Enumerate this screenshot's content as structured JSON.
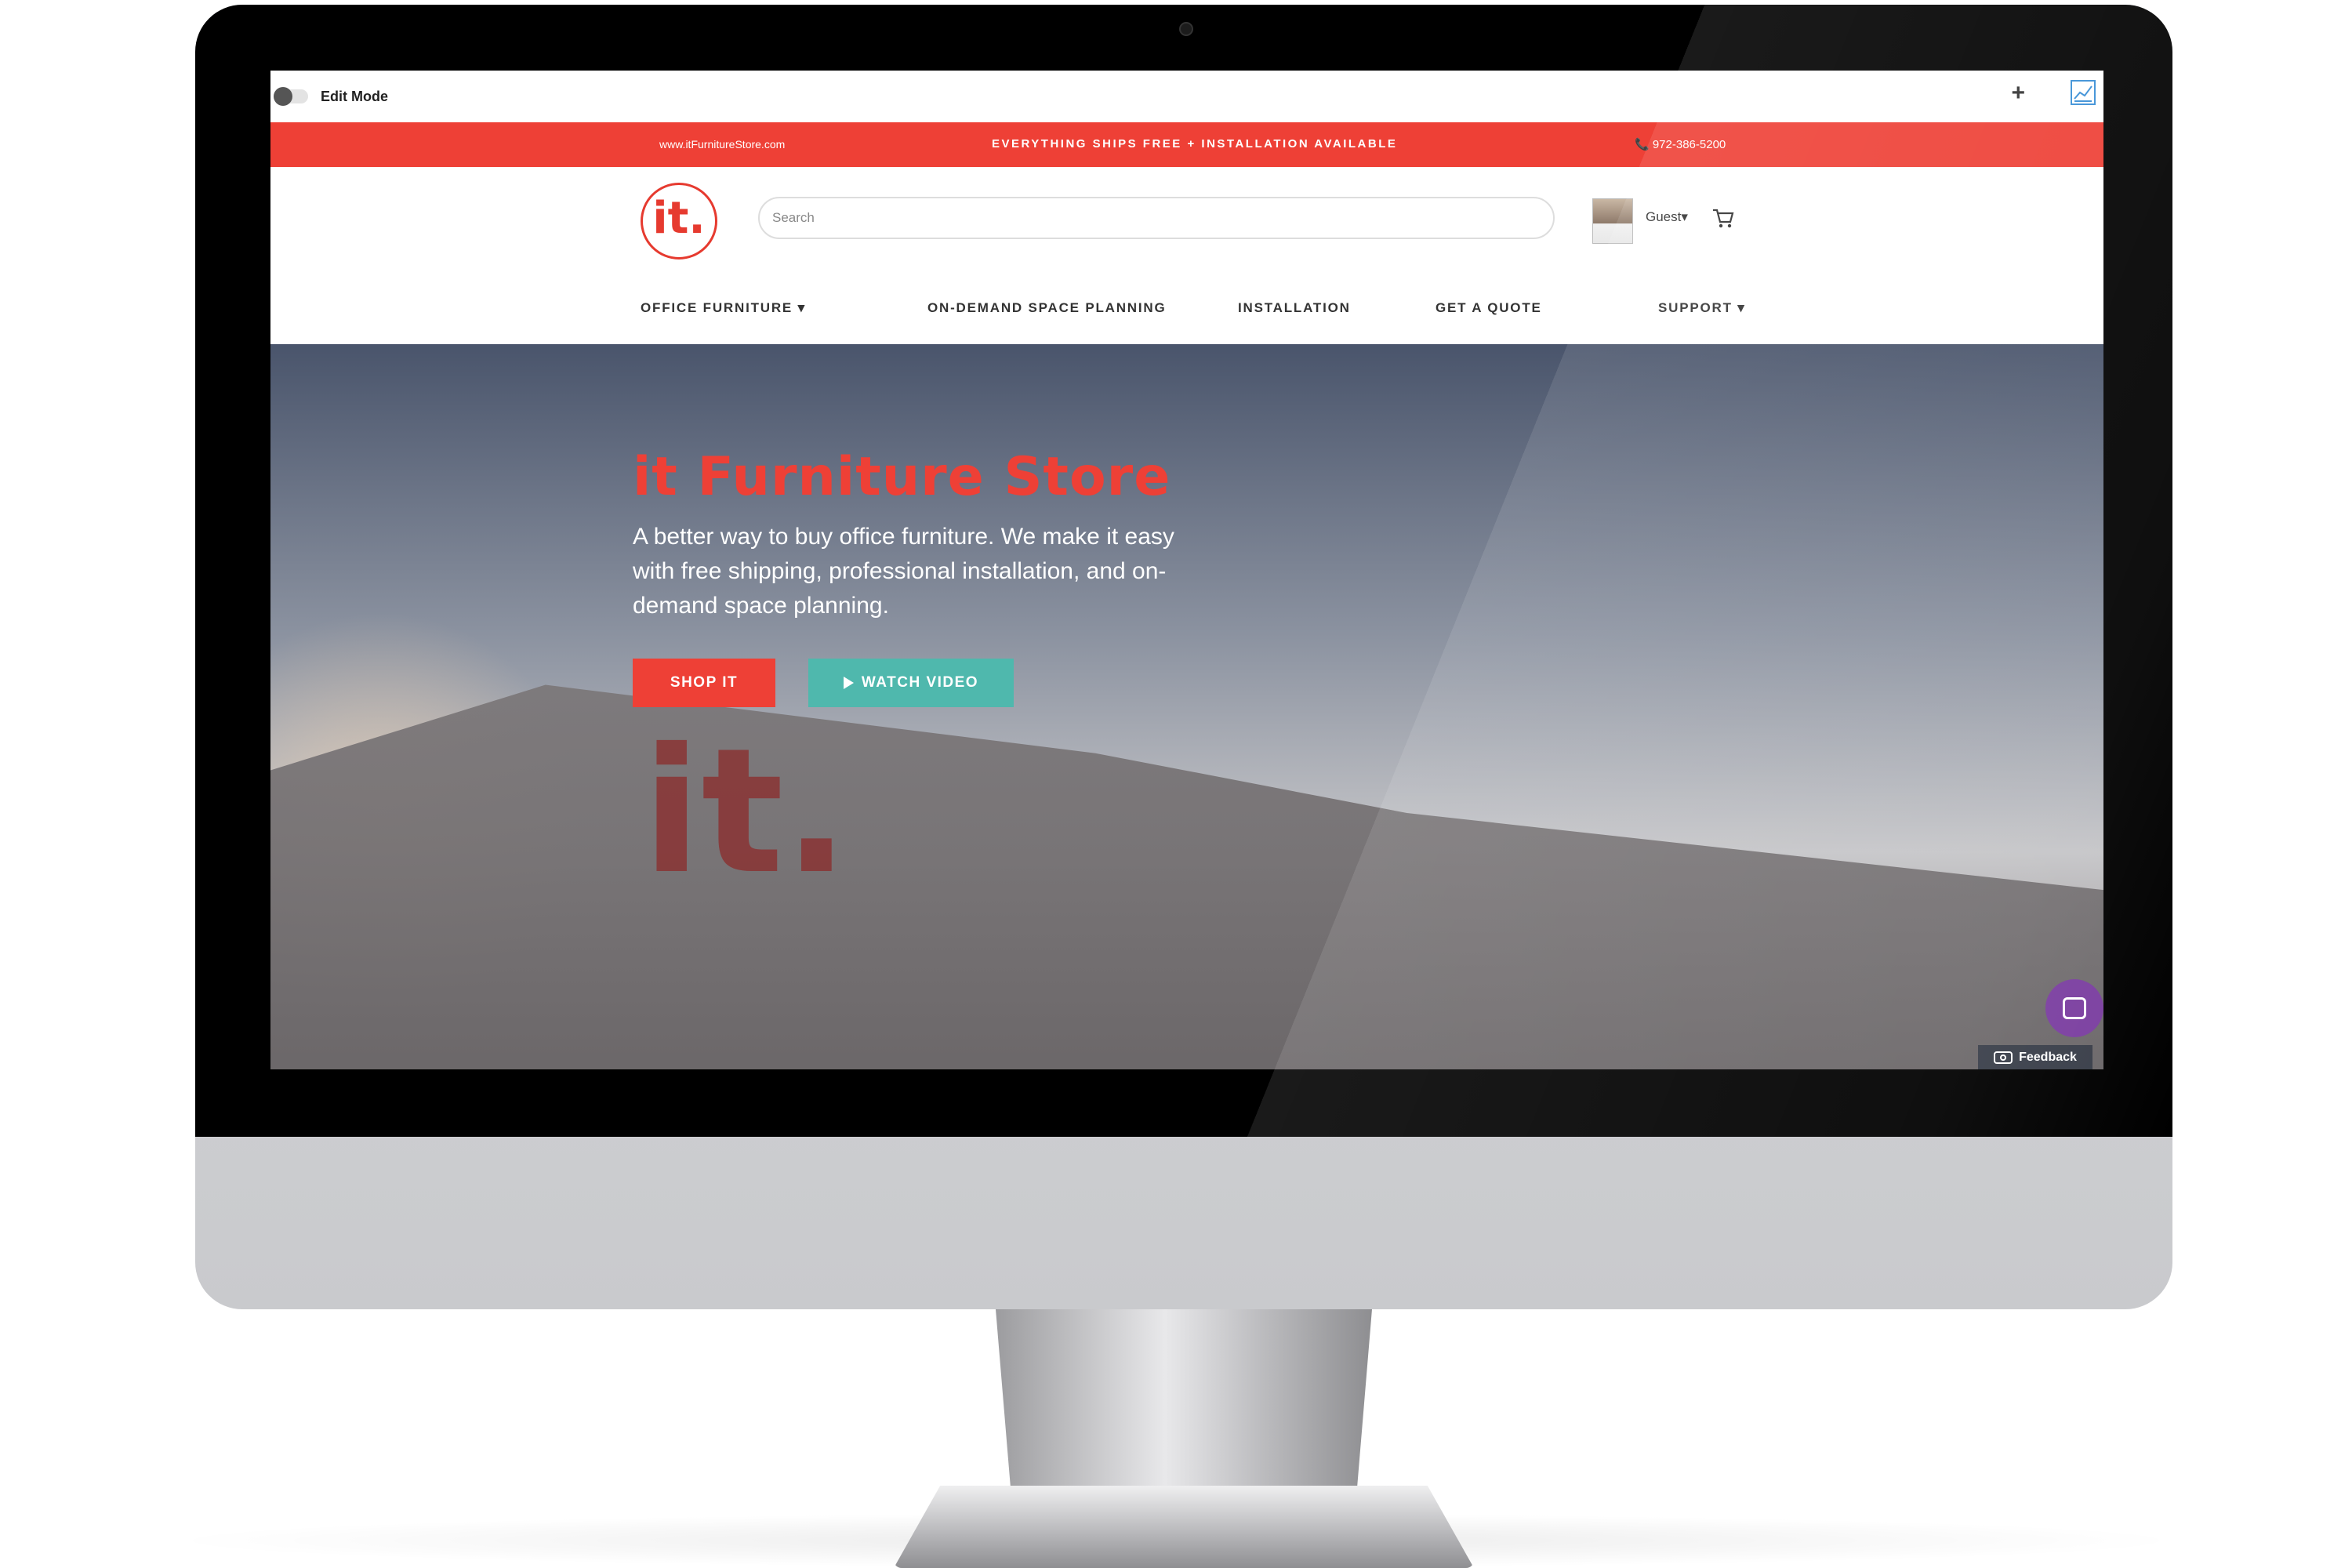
{
  "edit_bar": {
    "label": "Edit Mode",
    "plus": "+"
  },
  "promo": {
    "url": "www.itFurnitureStore.com",
    "message": "EVERYTHING SHIPS FREE + INSTALLATION AVAILABLE",
    "phone": "📞 972-386-5200"
  },
  "header": {
    "logo_text": "it.",
    "search_placeholder": "Search",
    "user_label": "Guest▾"
  },
  "nav": [
    {
      "label": "OFFICE FURNITURE ▾"
    },
    {
      "label": "ON-DEMAND SPACE PLANNING"
    },
    {
      "label": "INSTALLATION"
    },
    {
      "label": "GET A QUOTE"
    },
    {
      "label": "SUPPORT ▾"
    }
  ],
  "hero": {
    "title": "it Furniture Store",
    "description": "A better way to buy office furniture. We make it easy with free shipping, professional installation, and on-demand space planning.",
    "shop_button": "SHOP IT",
    "video_button": "WATCH VIDEO",
    "wall_sign": "it."
  },
  "widgets": {
    "feedback_label": "Feedback"
  },
  "colors": {
    "brand_red": "#ee4036",
    "teal": "#4fb8ad",
    "chat_purple": "#7b3fa0"
  }
}
